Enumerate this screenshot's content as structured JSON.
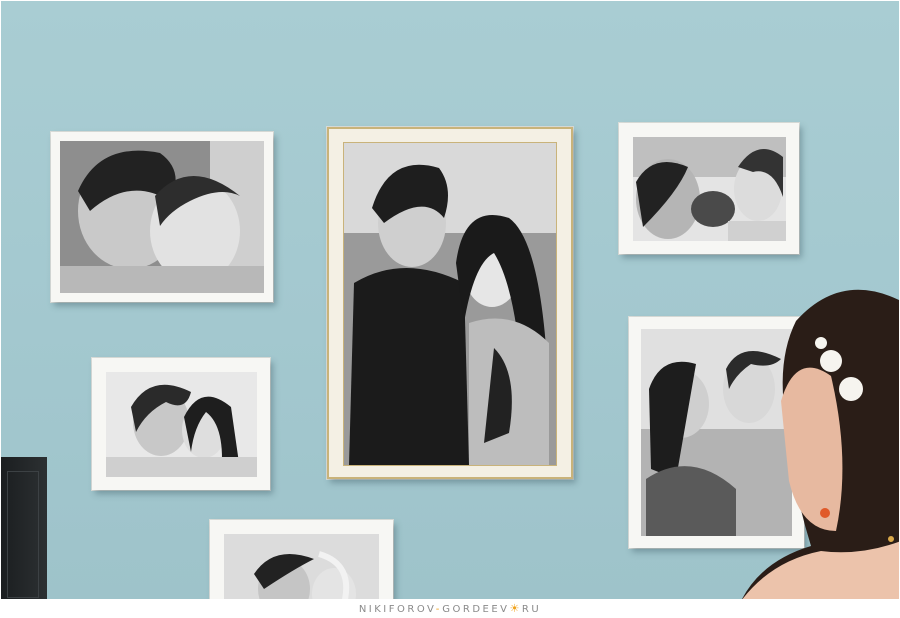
{
  "watermark": {
    "part1": "NIKIFOROV",
    "dash": "-",
    "part2": "GORDEEV",
    "sun": "☀",
    "part3": "RU"
  },
  "colors": {
    "wall": "#a6cad1",
    "frame_white": "#f7f7f4",
    "frame_gold": "#c9b37a",
    "watermark_text": "#8a8a8a",
    "watermark_sun": "#f0a21b"
  },
  "frames": [
    {
      "name": "frame-top-left",
      "style": "white",
      "subject": "couple selfie cheek to cheek"
    },
    {
      "name": "frame-center-large",
      "style": "gold",
      "subject": "couple standing by the sea"
    },
    {
      "name": "frame-top-right",
      "style": "white",
      "subject": "couple with small dog"
    },
    {
      "name": "frame-middle-left",
      "style": "white",
      "subject": "couple smiling together"
    },
    {
      "name": "frame-right-middle",
      "style": "white",
      "subject": "couple laughing at the beach"
    },
    {
      "name": "frame-bottom",
      "style": "white",
      "subject": "couple photo partially visible"
    }
  ]
}
